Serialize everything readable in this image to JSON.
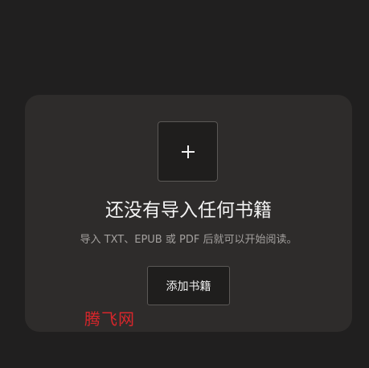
{
  "empty_state": {
    "add_icon": "plus-icon",
    "title": "还没有导入任何书籍",
    "subtitle": "导入 TXT、EPUB 或 PDF 后就可以开始阅读。",
    "button_label": "添加书籍"
  },
  "watermark": {
    "text": "腾飞网"
  },
  "colors": {
    "background": "#201f1f",
    "card": "#2e2c2b",
    "watermark": "#d8262b"
  }
}
